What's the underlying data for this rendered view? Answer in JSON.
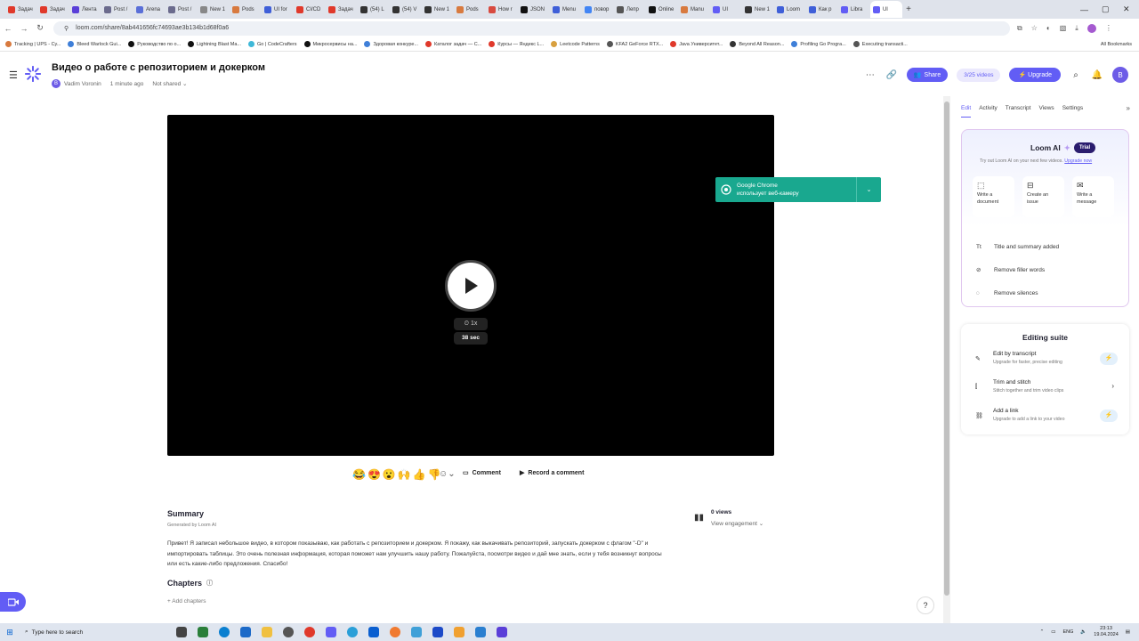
{
  "browser": {
    "tabs": [
      {
        "label": "Задач",
        "color": "#e0392b"
      },
      {
        "label": "Задач",
        "color": "#e0392b"
      },
      {
        "label": "Лента",
        "color": "#5a3fd8"
      },
      {
        "label": "Post /",
        "color": "#6b6b8d"
      },
      {
        "label": "Arena",
        "color": "#5a6fd8"
      },
      {
        "label": "Post /",
        "color": "#6b6b8d"
      },
      {
        "label": "New 1",
        "color": "#888888"
      },
      {
        "label": "Pods",
        "color": "#d87a3f"
      },
      {
        "label": "UI for",
        "color": "#3f5fd8"
      },
      {
        "label": "CI/CD",
        "color": "#e0392b"
      },
      {
        "label": "Задач",
        "color": "#e0392b"
      },
      {
        "label": "(54) L",
        "color": "#333333"
      },
      {
        "label": "(54) V",
        "color": "#333333"
      },
      {
        "label": "New 1",
        "color": "#333333"
      },
      {
        "label": "Pods",
        "color": "#d87a3f"
      },
      {
        "label": "How r",
        "color": "#d84a3f"
      },
      {
        "label": "JSON",
        "color": "#111111"
      },
      {
        "label": "Menu",
        "color": "#3f5fd8"
      },
      {
        "label": "повор",
        "color": "#4285f4"
      },
      {
        "label": "Лепр",
        "color": "#555555"
      },
      {
        "label": "Online",
        "color": "#111111"
      },
      {
        "label": "Manu",
        "color": "#d87a3f"
      },
      {
        "label": "UI",
        "color": "#625df5"
      },
      {
        "label": "New 1",
        "color": "#333333"
      },
      {
        "label": "Loom",
        "color": "#3f5fd8"
      },
      {
        "label": "Как р",
        "color": "#3f5fd8"
      },
      {
        "label": "Libra",
        "color": "#625df5"
      },
      {
        "label": "Ul",
        "color": "#625df5"
      }
    ],
    "active_tab_index": 27,
    "new_tab": "+",
    "url": "loom.com/share/8ab441656fc74693ae3b134b1d68f0a6",
    "bookmarks": [
      {
        "label": "Tracking | UPS - Су...",
        "color": "#d87a3f"
      },
      {
        "label": "Bleed Warlock Gui...",
        "color": "#3f7fd8"
      },
      {
        "label": "Руководство по о...",
        "color": "#111111"
      },
      {
        "label": "Lightning Blast Ma...",
        "color": "#111111"
      },
      {
        "label": "Go | CodeCrafters",
        "color": "#3fb8d8"
      },
      {
        "label": "Микросервисы на...",
        "color": "#111111"
      },
      {
        "label": "Здоровая конкуре...",
        "color": "#3f7fd8"
      },
      {
        "label": "Каталог задач — С...",
        "color": "#e0392b"
      },
      {
        "label": "Курсы — Яндекс L...",
        "color": "#e0392b"
      },
      {
        "label": "Leetcode Patterns",
        "color": "#d8a03f"
      },
      {
        "label": "KFA2 GeForce RTX...",
        "color": "#555555"
      },
      {
        "label": "Java Университет...",
        "color": "#e0392b"
      },
      {
        "label": "Beyond All Reason...",
        "color": "#333333"
      },
      {
        "label": "Profiling Go Progra...",
        "color": "#3f7fd8"
      },
      {
        "label": "Executing transacti...",
        "color": "#555555"
      }
    ],
    "all_bookmarks": "All Bookmarks"
  },
  "header": {
    "title": "Видео о работе с репозиторием и докерком",
    "author_initial": "B",
    "author": "Vadim Voronin",
    "time": "1 minute ago",
    "sharing": "Not shared",
    "share_label": "Share",
    "videos_count": "3/25 videos",
    "upgrade_label": "Upgrade",
    "user_initial": "B"
  },
  "player": {
    "speed": "1x",
    "duration": "38 sec"
  },
  "toast": {
    "line1": "Google Chrome",
    "line2": "использует веб-камеру"
  },
  "reactions": [
    "😂",
    "😍",
    "😮",
    "🙌",
    "👍",
    "👎"
  ],
  "actions": {
    "comment": "Comment",
    "record": "Record a comment"
  },
  "summary": {
    "heading": "Summary",
    "generated": "Generated by Loom AI",
    "text": "Привет! Я записал небольшое видео, в котором показываю, как работать с репозиторием и докерком. Я покажу, как выкачивать репозиторий, запускать докерком с флагом \"-D\" и импортировать таблицы. Это очень полезная информация, которая поможет нам улучшить нашу работу. Пожалуйста, посмотри видео и дай мне знать, если у тебя возникнут вопросы или есть какие-либо предложения. Спасибо!"
  },
  "views": {
    "count": "0 views",
    "engagement": "View engagement"
  },
  "chapters": {
    "heading": "Chapters",
    "add": "+ Add chapters"
  },
  "sidebar": {
    "tabs": [
      "Edit",
      "Activity",
      "Transcript",
      "Views",
      "Settings"
    ],
    "ai": {
      "title": "Loom AI",
      "trial": "Trial",
      "subtitle": "Try out Loom AI on your next few videos.",
      "upgrade_link": "Upgrade now",
      "actions": [
        {
          "line1": "Write a",
          "line2": "document",
          "icon": "doc-icon"
        },
        {
          "line1": "Create an",
          "line2": "issue",
          "icon": "issue-icon"
        },
        {
          "line1": "Write a",
          "line2": "message",
          "icon": "message-icon"
        }
      ],
      "items": [
        {
          "label": "Title and summary added",
          "icon": "title-icon"
        },
        {
          "label": "Remove filler words",
          "icon": "filler-icon"
        },
        {
          "label": "Remove silences",
          "icon": "silence-icon"
        }
      ]
    },
    "editing": {
      "title": "Editing suite",
      "rows": [
        {
          "title": "Edit by transcript",
          "subtitle": "Upgrade for faster, precise editing",
          "icon": "pencil-icon"
        },
        {
          "title": "Trim and stitch",
          "subtitle": "Stitch together and trim video clips",
          "icon": "scissors-icon"
        },
        {
          "title": "Add a link",
          "subtitle": "Upgrade to add a link to your video",
          "icon": "link-icon"
        }
      ]
    }
  },
  "taskbar": {
    "search_placeholder": "Type here to search",
    "lang": "ENG",
    "time": "23:13",
    "date": "19.04.2024"
  },
  "colors": {
    "accent": "#625df5",
    "toast": "#19a88f"
  }
}
